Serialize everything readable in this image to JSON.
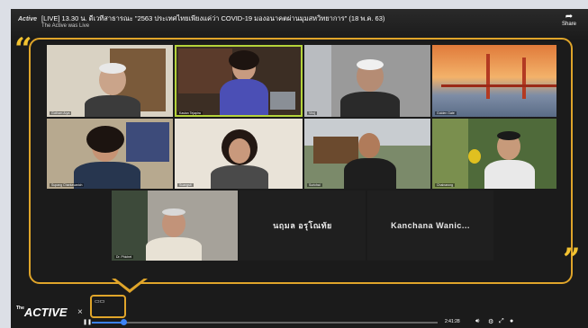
{
  "header": {
    "channel_logo": "Active",
    "title": "[LIVE] 13.30 น. ดีเวทีสาธารณะ \"2563 ประเทศไทยเพียงแค่ว่า COVID-19 มองอนาคตผ่านมุมสหวิทยาการ\" (18 พ.ค. 63)",
    "channel": "The Active was Live",
    "share_label": "Share"
  },
  "participants": [
    {
      "label": "Gothom Arya",
      "type": "video"
    },
    {
      "label": "Kasian Tejapira",
      "type": "video"
    },
    {
      "label": "Viroj",
      "type": "video"
    },
    {
      "label": "Golden Gate",
      "type": "video"
    },
    {
      "label": "Supang Chantavanich",
      "type": "video"
    },
    {
      "label": "Suangsit",
      "type": "video"
    },
    {
      "label": "Surichai",
      "type": "video"
    },
    {
      "label": "Chainarong",
      "type": "video"
    },
    {
      "label": "Dr. Phichet",
      "type": "video"
    },
    {
      "label": "นฤมล อรุโณทัย",
      "type": "name"
    },
    {
      "label": "Kanchana  Wanic...",
      "type": "name"
    }
  ],
  "footer": {
    "brand": "ACTIVE",
    "brand_prefix": "The",
    "times": "×",
    "time_display": "2:41:28"
  },
  "colors": {
    "accent": "#e0a52a",
    "speaker_border": "#b5d33a",
    "progress": "#3b82f6"
  },
  "player": {
    "progress_fraction": 0.09
  }
}
